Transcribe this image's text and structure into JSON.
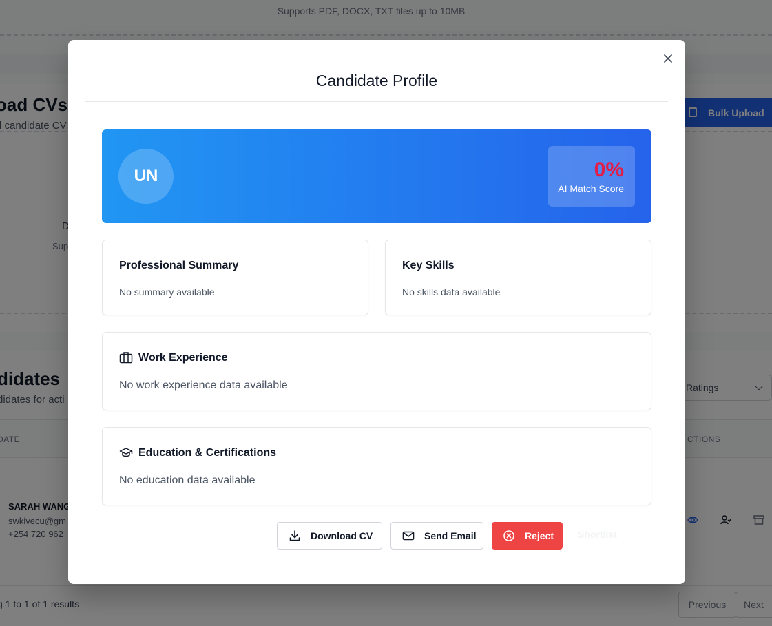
{
  "background": {
    "upload_hint": "Supports PDF, DOCX, TXT files up to 10MB",
    "upload_title": "oad CVs",
    "upload_subtitle": "d candidate CV",
    "bulk_upload_label": "Bulk Upload",
    "drop_title_fragment": "D",
    "drop_sub_fragment": "Sup",
    "candidates_title": "didates",
    "candidates_subtitle": "didates for acti",
    "filter_value": "Ratings",
    "table_header_left": "DATE",
    "table_header_right": "CTIONS",
    "row": {
      "name": "SARAH WANG",
      "email": "swkivecu@gm",
      "phone": "+254 720 962"
    },
    "results_text": "g 1 to 1 of 1 results",
    "previous_label": "Previous",
    "next_label": "Next"
  },
  "modal": {
    "title": "Candidate Profile",
    "close_icon": "close-icon",
    "avatar_initials": "UN",
    "score": {
      "value": "0%",
      "label": "AI Match Score"
    },
    "summary": {
      "title": "Professional Summary",
      "text": "No summary available"
    },
    "skills": {
      "title": "Key Skills",
      "text": "No skills data available"
    },
    "work": {
      "icon": "briefcase-icon",
      "title": "Work Experience",
      "text": "No work experience data available"
    },
    "education": {
      "icon": "graduation-cap-icon",
      "title": "Education & Certifications",
      "text": "No education data available"
    },
    "actions": {
      "download_label": "Download CV",
      "email_label": "Send Email",
      "reject_label": "Reject",
      "ghost_label": "Shortlist"
    }
  },
  "colors": {
    "accent": "#2563eb",
    "hero_start": "#2196f3",
    "danger": "#ef4444",
    "score": "#e11d48"
  }
}
